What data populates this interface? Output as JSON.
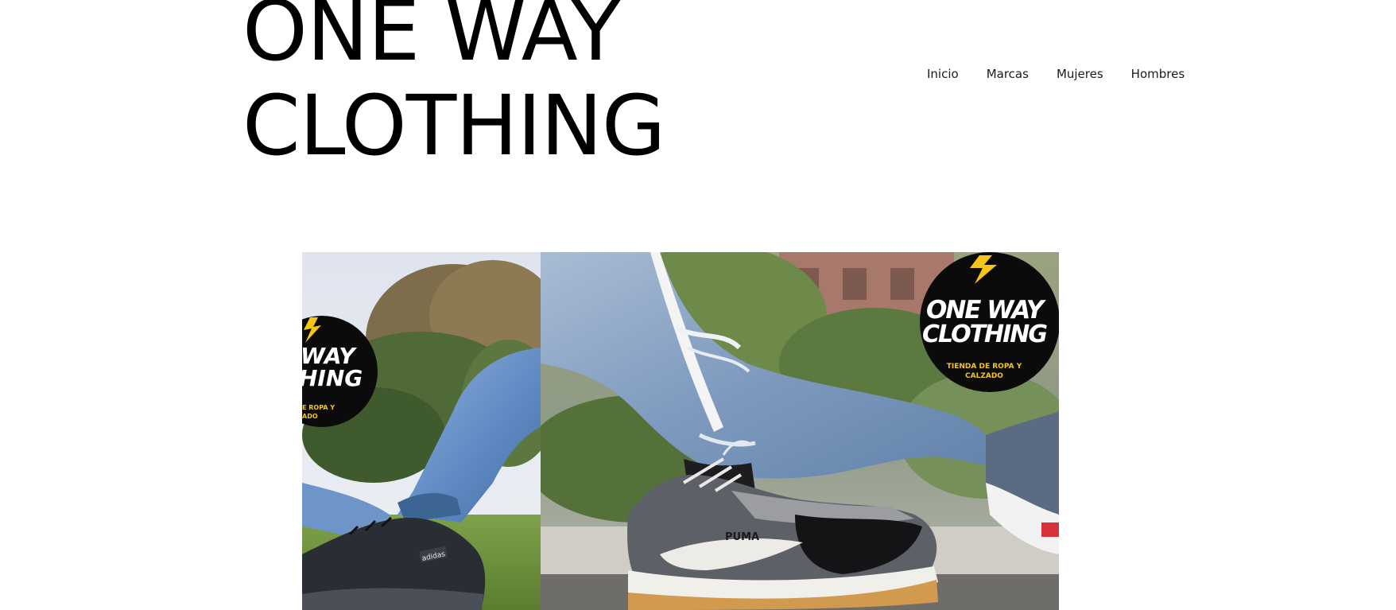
{
  "header": {
    "site_title": "ONE WAY CLOTHING"
  },
  "nav": {
    "items": [
      {
        "label": "Inicio"
      },
      {
        "label": "Marcas"
      },
      {
        "label": "Mujeres"
      },
      {
        "label": "Hombres"
      }
    ]
  },
  "gallery": {
    "left_photo": {
      "badge_line1": "WAY",
      "badge_line2": "HING",
      "badge_tag1": "E ROPA Y",
      "badge_tag2": "ADO",
      "shoe_brand": "adidas"
    },
    "right_photo": {
      "badge_line1": "ONE WAY",
      "badge_line2": "CLOTHING",
      "badge_tag1": "TIENDA DE ROPA Y",
      "badge_tag2": "CALZADO",
      "shoe_brand": "PUMA"
    }
  },
  "colors": {
    "background": "#ffffff",
    "title": "#000000",
    "nav_text": "#1a1a1a",
    "badge_black": "#0b0b0b",
    "badge_yellow": "#f5c518",
    "denim": "#6f95c4"
  }
}
